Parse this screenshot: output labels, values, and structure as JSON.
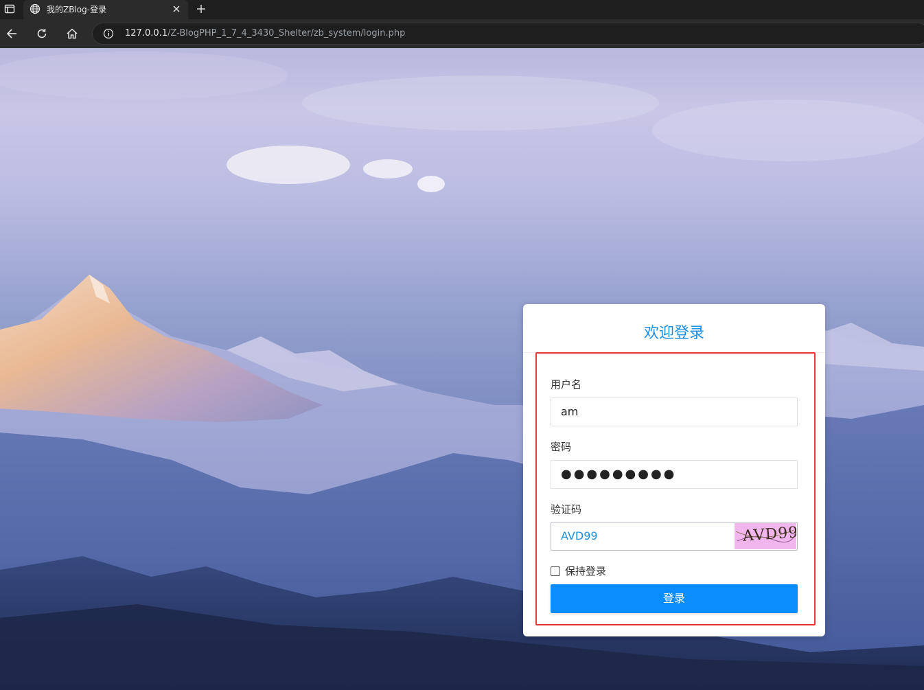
{
  "browser": {
    "tab_title": "我的ZBlog-登录",
    "url_host": "127.0.0.1",
    "url_path": "/Z-BlogPHP_1_7_4_3430_Shelter/zb_system/login.php",
    "icons": {
      "tab_panel": "tab-panel-icon",
      "favicon": "globe-icon",
      "close": "close-icon",
      "new_tab": "plus-icon",
      "back": "arrow-left-icon",
      "reload": "reload-icon",
      "home": "home-icon",
      "info": "info-icon"
    }
  },
  "login": {
    "title": "欢迎登录",
    "username_label": "用户名",
    "username_value": "am",
    "password_label": "密码",
    "password_value": "●●●●●●●●●",
    "captcha_label": "验证码",
    "captcha_value": "AVD99",
    "captcha_image_text": "AVD99",
    "remember_label": "保持登录",
    "remember_checked": false,
    "submit_label": "登录"
  },
  "colors": {
    "accent": "#1e8fe0",
    "button": "#0b8cff",
    "highlight": "#e5383b",
    "captcha_bg": "#f1b6ee"
  }
}
